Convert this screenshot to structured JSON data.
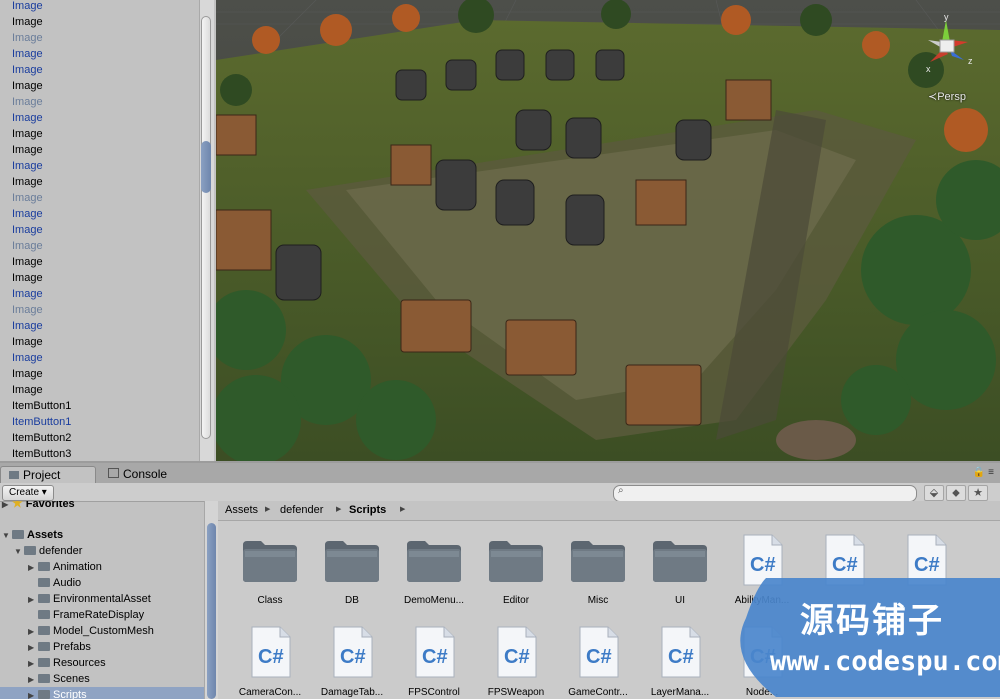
{
  "hierarchy": {
    "items": [
      {
        "label": "Image",
        "tone": "blue"
      },
      {
        "label": "Image",
        "tone": "normal"
      },
      {
        "label": "Image",
        "tone": "gray"
      },
      {
        "label": "Image",
        "tone": "blue"
      },
      {
        "label": "Image",
        "tone": "blue"
      },
      {
        "label": "Image",
        "tone": "normal"
      },
      {
        "label": "Image",
        "tone": "gray"
      },
      {
        "label": "Image",
        "tone": "blue"
      },
      {
        "label": "Image",
        "tone": "normal"
      },
      {
        "label": "Image",
        "tone": "normal"
      },
      {
        "label": "Image",
        "tone": "blue"
      },
      {
        "label": "Image",
        "tone": "normal"
      },
      {
        "label": "Image",
        "tone": "gray"
      },
      {
        "label": "Image",
        "tone": "blue"
      },
      {
        "label": "Image",
        "tone": "blue"
      },
      {
        "label": "Image",
        "tone": "gray"
      },
      {
        "label": "Image",
        "tone": "normal"
      },
      {
        "label": "Image",
        "tone": "normal"
      },
      {
        "label": "Image",
        "tone": "blue"
      },
      {
        "label": "Image",
        "tone": "gray"
      },
      {
        "label": "Image",
        "tone": "blue"
      },
      {
        "label": "Image",
        "tone": "normal"
      },
      {
        "label": "Image",
        "tone": "blue"
      },
      {
        "label": "Image",
        "tone": "normal"
      },
      {
        "label": "Image",
        "tone": "normal"
      },
      {
        "label": "ItemButton1",
        "tone": "normal"
      },
      {
        "label": "ItemButton1",
        "tone": "blue"
      },
      {
        "label": "ItemButton2",
        "tone": "normal"
      },
      {
        "label": "ItemButton3",
        "tone": "normal"
      }
    ]
  },
  "scene": {
    "projection_label": "Persp",
    "gizmo_axes": {
      "y": "y",
      "x": "x",
      "z": "z"
    }
  },
  "tabs": {
    "project": "Project",
    "console": "Console"
  },
  "toolbar": {
    "create_label": "Create",
    "search_placeholder": ""
  },
  "tree": {
    "favorites": "Favorites",
    "assets": "Assets",
    "defender": "defender",
    "children": [
      "Animation",
      "Audio",
      "EnvironmentalAsset",
      "FrameRateDisplay",
      "Model_CustomMesh",
      "Prefabs",
      "Resources",
      "Scenes",
      "Scripts"
    ]
  },
  "breadcrumb": [
    "Assets",
    "defender",
    "Scripts"
  ],
  "assets_row1": [
    {
      "name": "Class",
      "kind": "folder"
    },
    {
      "name": "DB",
      "kind": "folder"
    },
    {
      "name": "DemoMenu...",
      "kind": "folder"
    },
    {
      "name": "Editor",
      "kind": "folder"
    },
    {
      "name": "Misc",
      "kind": "folder"
    },
    {
      "name": "UI",
      "kind": "folder"
    },
    {
      "name": "AbilityMan...",
      "kind": "script"
    },
    {
      "name": "",
      "kind": "script"
    },
    {
      "name": "",
      "kind": "script"
    }
  ],
  "assets_row2": [
    {
      "name": "CameraCon...",
      "kind": "script"
    },
    {
      "name": "DamageTab...",
      "kind": "script"
    },
    {
      "name": "FPSControl",
      "kind": "script"
    },
    {
      "name": "FPSWeapon",
      "kind": "script"
    },
    {
      "name": "GameContr...",
      "kind": "script"
    },
    {
      "name": "LayerMana...",
      "kind": "script"
    },
    {
      "name": "Node...",
      "kind": "script"
    }
  ],
  "watermark": {
    "title": "源码铺子",
    "url": "www.codespu.com"
  },
  "colors": {
    "selection": "#8fa3c3",
    "hierarchy_blue": "#1a3d9e",
    "watermark_blue": "#4a86cc"
  }
}
